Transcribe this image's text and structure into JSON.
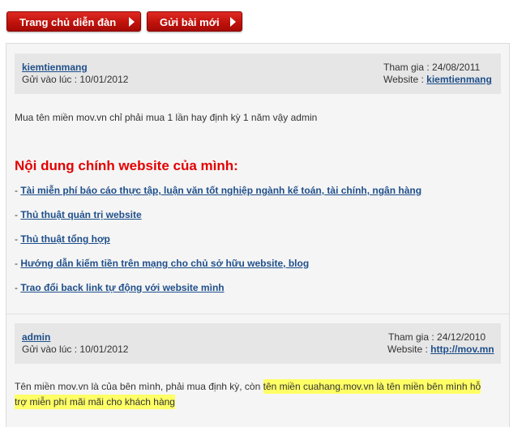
{
  "toolbar": {
    "home_label": "Trang chủ diễn đàn",
    "new_post_label": "Gửi bài mới"
  },
  "posts": [
    {
      "author": "kiemtienmang",
      "date_label": "Gửi vào lúc : 10/01/2012",
      "join_label": "Tham gia : 24/08/2011",
      "website_prefix": "Website : ",
      "website_value": "kiemtienmang",
      "message": "Mua tên miền mov.vn chỉ phải mua 1 lần hay định kỳ 1 năm vậy admin",
      "signature_heading": "Nội dung chính website của mình:",
      "signature_links": [
        "Tài miễn phí báo cáo thực tập, luận văn tốt nghiệp ngành kế toán, tài chính, ngân hàng",
        "Thủ thuật quản trị website",
        "Thủ thuật tổng hợp",
        "Hướng dẫn kiếm tiền trên mạng cho chủ sở hữu website, blog",
        "Trao đổi back link tự động với website mình"
      ],
      "link_prefix": "- "
    },
    {
      "author": "admin",
      "date_label": "Gửi vào lúc : 10/01/2012",
      "join_label": "Tham gia : 24/12/2010",
      "website_prefix": "Website : ",
      "website_value": "http://mov.mn",
      "message_plain": "Tên miền mov.vn là của bên mình, phải mua định kỳ, còn ",
      "message_highlight_1": "tên miền cuahang.mov.vn là tên miền bên mình hỗ",
      "message_highlight_2": "trợ miễn phí mãi mãi cho khách hàng"
    }
  ],
  "colors": {
    "button_red": "#c1120c",
    "heading_red": "#e30000",
    "link_blue": "#1f4f8a",
    "highlight": "#ffff66"
  }
}
